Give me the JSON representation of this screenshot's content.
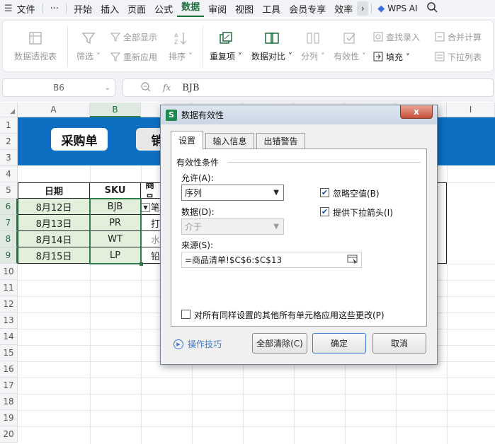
{
  "menubar": {
    "file": "文件",
    "more": "···",
    "tabs": [
      "开始",
      "插入",
      "页面",
      "公式",
      "数据",
      "审阅",
      "视图",
      "工具",
      "会员专享",
      "效率"
    ],
    "active_tab": "数据",
    "wps_ai": "WPS AI"
  },
  "ribbon": {
    "pivot": "数据透视表",
    "filter": "筛选",
    "show_all": "全部显示",
    "reapply": "重新应用",
    "sort": "排序",
    "duplicates": "重复项",
    "compare": "数据对比",
    "split": "分列",
    "validity": "有效性",
    "fill": "填充",
    "find_entry": "查找录入",
    "consolidate": "合并计算",
    "dropdown_list": "下拉列表"
  },
  "formula_bar": {
    "cell_ref": "B6",
    "fx": "fx",
    "value": "BJB"
  },
  "grid": {
    "columns": [
      "A",
      "B",
      "C",
      "D",
      "E",
      "F",
      "G",
      "H",
      "I"
    ],
    "rows": [
      "1",
      "2",
      "3",
      "4",
      "5",
      "6",
      "7",
      "8",
      "9",
      "10",
      "11",
      "12",
      "13",
      "14",
      "15",
      "16",
      "17",
      "18",
      "19",
      "20"
    ],
    "selected_column": "B",
    "banner_buttons": [
      "采购单",
      "销"
    ],
    "table_headers": [
      "日期",
      "SKU",
      "商品"
    ],
    "table_rows": [
      {
        "date": "8月12日",
        "sku": "BJB",
        "product_partial": "笔"
      },
      {
        "date": "8月13日",
        "sku": "PR",
        "product_partial": "打"
      },
      {
        "date": "8月14日",
        "sku": "WT",
        "product_partial": "水"
      },
      {
        "date": "8月15日",
        "sku": "LP",
        "product_partial": "铅"
      }
    ]
  },
  "dialog": {
    "title": "数据有效性",
    "close": "x",
    "tabs": [
      "设置",
      "输入信息",
      "出错警告"
    ],
    "active_tab": "设置",
    "group_label": "有效性条件",
    "allow_label": "允许(A):",
    "allow_value": "序列",
    "data_label": "数据(D):",
    "data_value": "介于",
    "ignore_blank_label": "忽略空值(B)",
    "ignore_blank_checked": true,
    "dropdown_arrow_label": "提供下拉箭头(I)",
    "dropdown_arrow_checked": true,
    "source_label": "来源(S):",
    "source_value": "=商品清单!$C$6:$C$13",
    "apply_all_label": "对所有同样设置的其他所有单元格应用这些更改(P)",
    "apply_all_checked": false,
    "tips_label": "操作技巧",
    "clear_all": "全部清除(C)",
    "ok": "确定",
    "cancel": "取消"
  }
}
